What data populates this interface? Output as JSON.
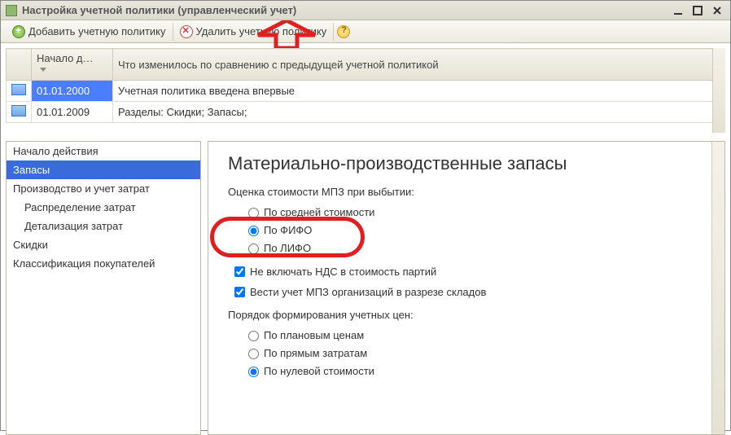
{
  "window": {
    "title": "Настройка учетной политики (управленческий учет)"
  },
  "toolbar": {
    "add_label": "Добавить учетную политику",
    "del_label": "Удалить учетную политику"
  },
  "history_table": {
    "col_date": "Начало д…",
    "col_changes": "Что изменилось по сравнению с предыдущей учетной политикой",
    "rows": [
      {
        "date": "01.01.2000",
        "changes": "Учетная политика введена впервые"
      },
      {
        "date": "01.01.2009",
        "changes": "Разделы: Скидки; Запасы;"
      }
    ]
  },
  "sidebar": {
    "items": [
      {
        "label": "Начало действия",
        "indent": false,
        "selected": false
      },
      {
        "label": "Запасы",
        "indent": false,
        "selected": true
      },
      {
        "label": "Производство и учет затрат",
        "indent": false,
        "selected": false
      },
      {
        "label": "Распределение затрат",
        "indent": true,
        "selected": false
      },
      {
        "label": "Детализация затрат",
        "indent": true,
        "selected": false
      },
      {
        "label": "Скидки",
        "indent": false,
        "selected": false
      },
      {
        "label": "Классификация покупателей",
        "indent": false,
        "selected": false
      }
    ]
  },
  "content": {
    "heading": "Материально-производственные запасы",
    "group1_label": "Оценка стоимости МПЗ при выбытии:",
    "opt_avg": "По средней стоимости",
    "opt_fifo": "По ФИФО",
    "opt_lifo": "По ЛИФО",
    "chk_vat": "Не включать НДС в стоимость партий",
    "chk_wh": "Вести учет МПЗ организаций в разрезе складов",
    "group2_label": "Порядок формирования учетных цен:",
    "opt_plan": "По плановым ценам",
    "opt_direct": "По прямым затратам",
    "opt_zero": "По нулевой стоимости"
  }
}
